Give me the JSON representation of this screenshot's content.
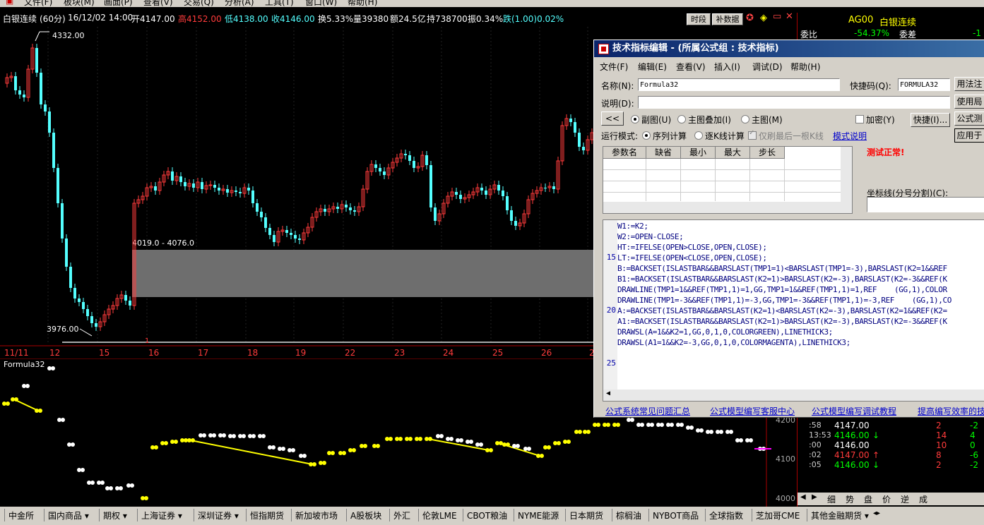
{
  "menubar": {
    "items": [
      "文件(F)",
      "板块(M)",
      "画面(P)",
      "查看(V)",
      "交易(Q)",
      "分析(A)",
      "工具(T)",
      "窗口(W)",
      "帮助(H)"
    ]
  },
  "infobar": {
    "instrument": "白银连续",
    "period": "(60分)",
    "datetime": "16/12/02 14:00",
    "open": "开4147.00",
    "high": "高4152.00",
    "low": "低4138.00",
    "close": "收4146.00",
    "turnover_rate": "换5.33%",
    "volume": "量39380",
    "amount": "额24.5亿",
    "open_interest": "持738700",
    "amplitude": "振0.34%",
    "change": "跌(1.00)0.02%"
  },
  "top_buttons": {
    "time_share": "时段",
    "backfill": "补数据"
  },
  "chart": {
    "high_label": "4332.00",
    "low_label": "3976.00",
    "zone_label": "4019.0 - 4076.0",
    "dates": [
      "11/11",
      "12",
      "15",
      "16",
      "17",
      "18",
      "19",
      "22",
      "23",
      "24",
      "25",
      "26",
      "2"
    ],
    "zone_marker": "1"
  },
  "subchart": {
    "name": "Formula32",
    "y_labels": [
      "4200",
      "4100",
      "4000"
    ]
  },
  "right_panel": {
    "code": "AG00",
    "name": "白银连续",
    "ratio_label": "委比",
    "ratio_value": "-54.37%",
    "diff_label": "委差",
    "diff_value": "-1",
    "ticks": [
      {
        "time": ":58",
        "price": "4147.00",
        "arrow": "",
        "vol": "2",
        "chg": "-2"
      },
      {
        "time": "13:53",
        "price": "4146.00",
        "arrow": "↓",
        "vol": "14",
        "chg": "4"
      },
      {
        "time": ":00",
        "price": "4146.00",
        "arrow": "",
        "vol": "10",
        "chg": "0"
      },
      {
        "time": ":02",
        "price": "4147.00",
        "arrow": "↑",
        "vol": "8",
        "chg": "-6"
      },
      {
        "time": ":05",
        "price": "4146.00",
        "arrow": "↓",
        "vol": "2",
        "chg": "-2"
      }
    ],
    "tabs": [
      "细",
      "势",
      "盘",
      "价",
      "逆",
      "成"
    ]
  },
  "dialog": {
    "title": "技术指标编辑 - (所属公式组 : 技术指标)",
    "menu": [
      "文件(F)",
      "编辑(E)",
      "查看(V)",
      "插入(I)",
      "调试(D)",
      "帮助(H)"
    ],
    "name_label": "名称(N):",
    "name_value": "Formula32",
    "shortcut_label": "快捷码(Q):",
    "shortcut_value": "FORMULA32",
    "desc_label": "说明(D):",
    "desc_value": "",
    "collapse_btn": "<<",
    "radio_sub": "副图(U)",
    "radio_overlay": "主图叠加(I)",
    "radio_main": "主图(M)",
    "encrypt": "加密(Y)",
    "quick_btn": "快捷(I)...",
    "mode_label": "运行模式:",
    "mode_seq": "序列计算",
    "mode_bar": "逐K线计算",
    "mode_last": "仅刷最后一根K线",
    "mode_help": "模式说明",
    "side_btns": [
      "用法注",
      "使用局",
      "公式测",
      "应用于"
    ],
    "param_headers": [
      "参数名",
      "缺省",
      "最小",
      "最大",
      "步长"
    ],
    "test_status": "测试正常!",
    "axis_label": "坐标线(分号分割)(C):",
    "line_numbers": [
      "15",
      "20",
      "25"
    ],
    "code_lines": [
      "W1:=K2;",
      "W2:=OPEN-CLOSE;",
      "HT:=IFELSE(OPEN>CLOSE,OPEN,CLOSE);",
      "LT:=IFELSE(OPEN<CLOSE,OPEN,CLOSE);",
      "B:=BACKSET(ISLASTBAR&&BARSLAST(TMP1=1)<BARSLAST(TMP1=-3),BARSLAST(K2=1&&REF",
      "B1:=BACKSET(ISLASTBAR&&BARSLAST(K2=1)>BARSLAST(K2=-3),BARSLAST(K2=-3&&REF(K",
      "DRAWLINE(TMP1=1&&REF(TMP1,1)=1,GG,TMP1=1&&REF(TMP1,1)=1,REF    (GG,1),COLOR",
      "DRAWLINE(TMP1=-3&&REF(TMP1,1)=-3,GG,TMP1=-3&&REF(TMP1,1)=-3,REF    (GG,1),CO",
      "A:=BACKSET(ISLASTBAR&&BARSLAST(K2=1)<BARSLAST(K2=-3),BARSLAST(K2=1&&REF(K2=",
      "A1:=BACKSET(ISLASTBAR&&BARSLAST(K2=1)>BARSLAST(K2=-3),BARSLAST(K2=-3&&REF(K",
      "DRAWSL(A=1&&K2=1,GG,0,1,0,COLORGREEN),LINETHICK3;",
      "DRAWSL(A1=1&&K2=-3,GG,0,1,0,COLORMAGENTA),LINETHICK3;"
    ],
    "links": [
      "公式系统常见问题汇总",
      "公式模型编写客服中心",
      "公式模型编写调试教程",
      "提高编写效率的技"
    ]
  },
  "bottom_tabs": [
    "中金所",
    "国内商品",
    "期权",
    "上海证券",
    "深圳证券",
    "恒指期货",
    "新加坡市场",
    "A股板块",
    "外汇",
    "伦敦LME",
    "CBOT粮油",
    "NYME能源",
    "日本期货",
    "棕榈油",
    "NYBOT商品",
    "全球指数",
    "芝加哥CME",
    "其他金融期货"
  ],
  "colors": {
    "up": "#ff3b3b",
    "down": "#54ffff",
    "zone": "#6e6e6e",
    "dot_yellow": "#ffff00",
    "dot_white": "#ffffff",
    "axis": "#aa0000"
  }
}
